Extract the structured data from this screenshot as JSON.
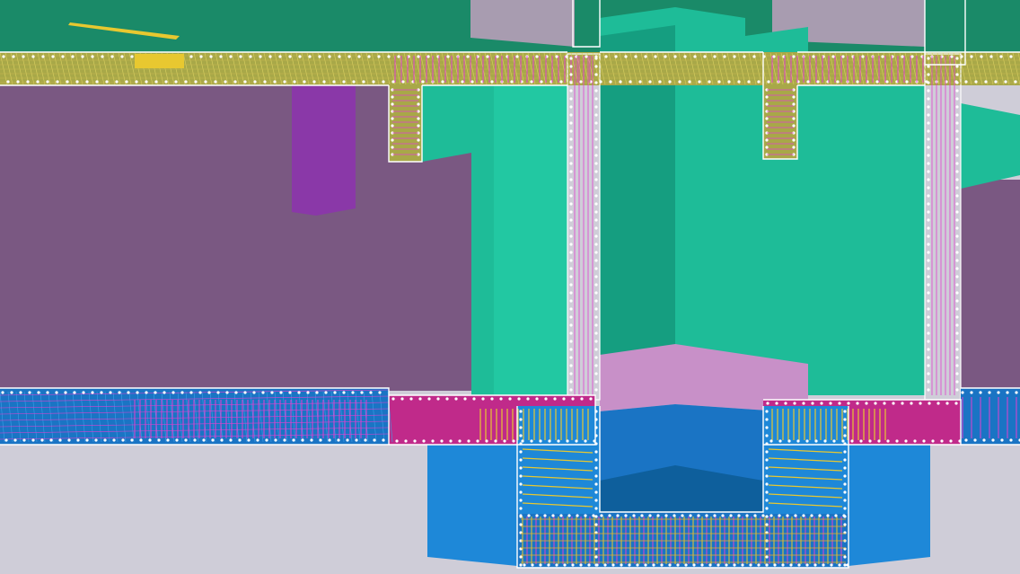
{
  "scene": {
    "description_free": true,
    "colors": {
      "background": "#cfcdd8",
      "top_band": "#1a8a68",
      "wall": "#7a5882",
      "concrete_green": "#1ebc98",
      "concrete_green_dark": "#159e80",
      "slab_blue": "#1a74c4",
      "pit_blue": "#1e88d8",
      "magenta": "#c02a8a",
      "rebar_yellow": "#e8c830",
      "rebar_pink": "#e040d0",
      "mesh_olive": "#b8b848",
      "column_purple": "#8a38a8",
      "pink_wall": "#c890c8",
      "grey_block": "#a89cb0"
    }
  }
}
